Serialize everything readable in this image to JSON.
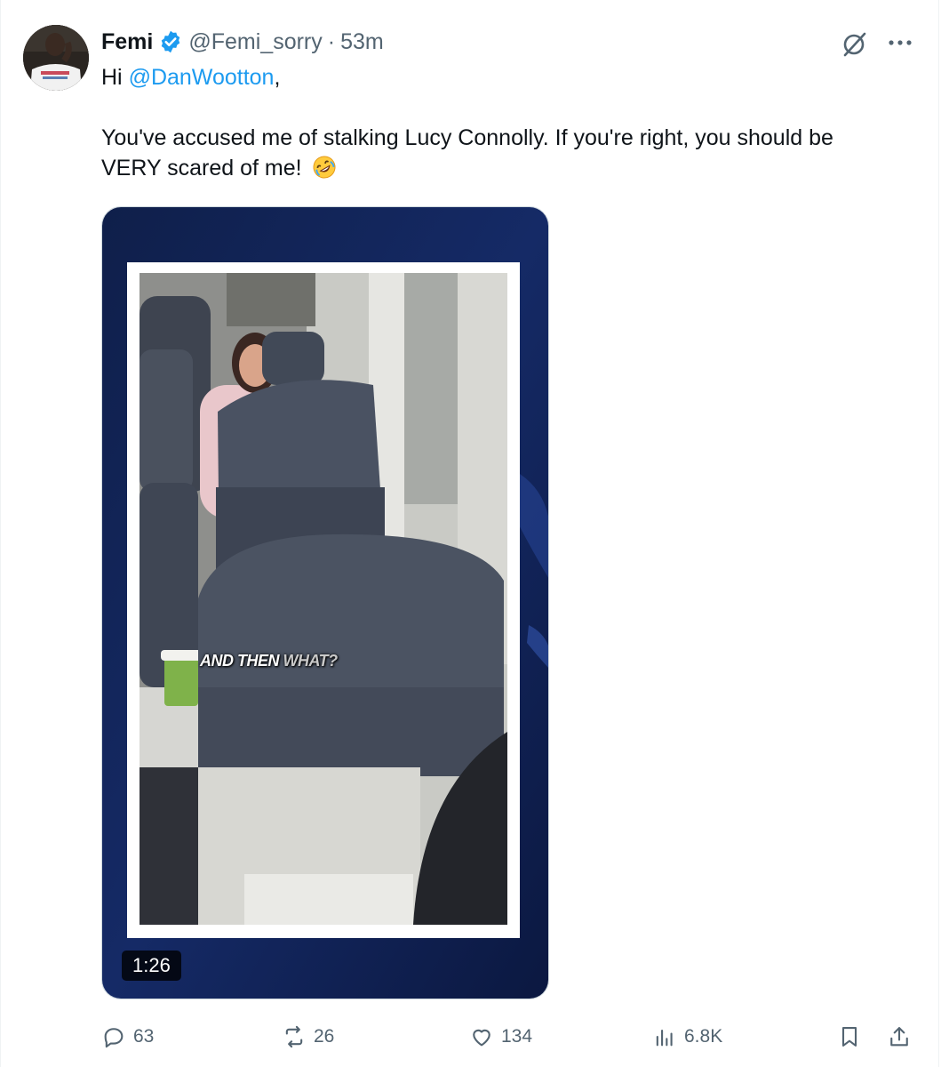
{
  "tweet": {
    "author_name": "Femi",
    "handle": "@Femi_sorry",
    "separator": "·",
    "time": "53m",
    "greeting_prefix": "Hi ",
    "mention": "@DanWootton",
    "greeting_suffix": ",",
    "body_line1": "You've accused me of stalking Lucy Connolly. If you're right, you should be",
    "body_line2": "VERY scared of me! ",
    "emoji": "rolling-on-floor-laughing"
  },
  "media": {
    "caption_bright": "AND THEN ",
    "caption_dim": "WHAT?",
    "duration": "1:26"
  },
  "actions": {
    "replies": "63",
    "reposts": "26",
    "likes": "134",
    "views": "6.8K"
  },
  "colors": {
    "accent": "#1d9bf0",
    "muted": "#536471",
    "verified": "#1d9bf0"
  },
  "icons": [
    "verified-badge-icon",
    "grok-icon",
    "more-icon",
    "reply-icon",
    "repost-icon",
    "like-icon",
    "views-icon",
    "bookmark-icon",
    "share-icon"
  ]
}
